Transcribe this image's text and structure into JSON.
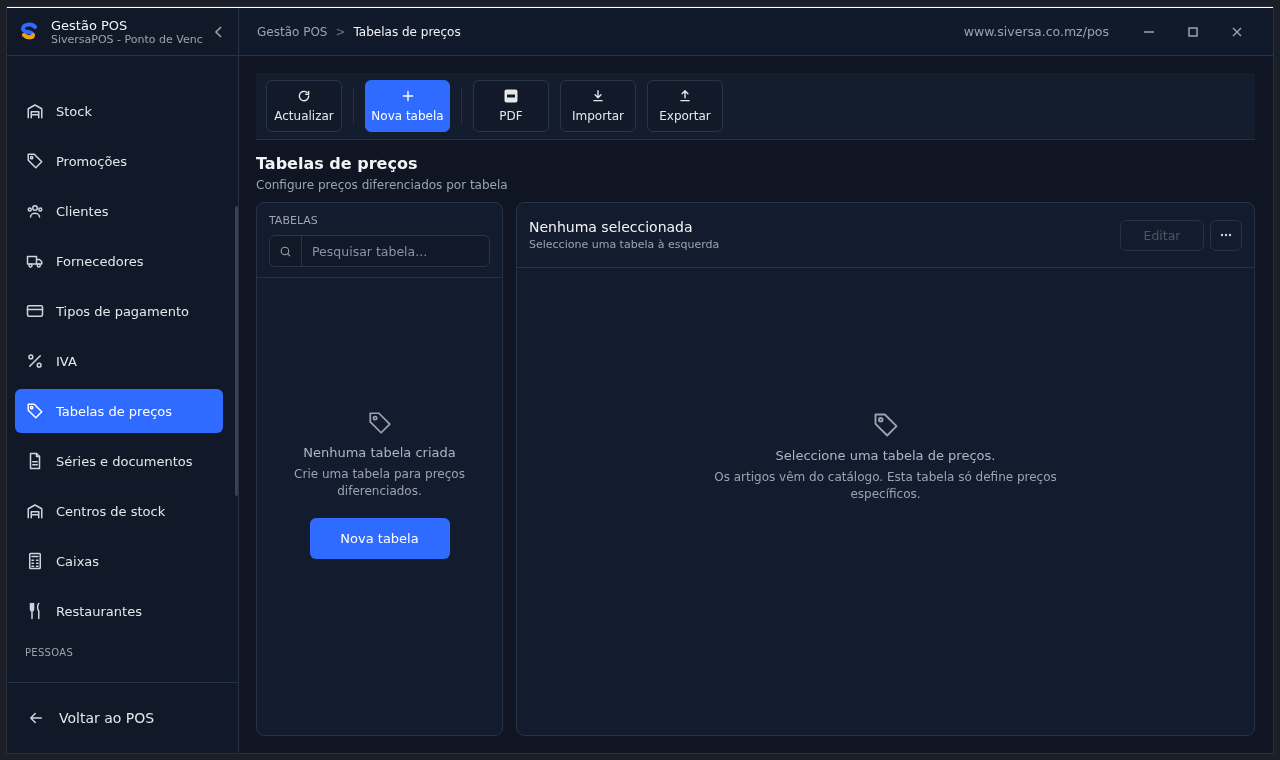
{
  "app": {
    "title": "Gestão POS",
    "subtitle": "SiversaPOS - Ponto de Venc"
  },
  "sidebar": {
    "items": [
      {
        "label": "Stock",
        "selected": false
      },
      {
        "label": "Promoções",
        "selected": false
      },
      {
        "label": "Clientes",
        "selected": false
      },
      {
        "label": "Fornecedores",
        "selected": false
      },
      {
        "label": "Tipos de pagamento",
        "selected": false
      },
      {
        "label": "IVA",
        "selected": false
      },
      {
        "label": "Tabelas de preços",
        "selected": true
      },
      {
        "label": "Séries e documentos",
        "selected": false
      },
      {
        "label": "Centros de stock",
        "selected": false
      },
      {
        "label": "Caixas",
        "selected": false
      },
      {
        "label": "Restaurantes",
        "selected": false
      }
    ],
    "section": "PESSOAS",
    "back": "Voltar ao POS"
  },
  "topbar": {
    "breadcrumb": [
      "Gestão POS",
      "Tabelas de preços"
    ],
    "separator": ">",
    "url": "www.siversa.co.mz/pos"
  },
  "toolbar": [
    {
      "label": "Actualizar",
      "kind": "default"
    },
    {
      "label": "Nova tabela",
      "kind": "primary"
    },
    {
      "label": "PDF",
      "kind": "default"
    },
    {
      "label": "Importar",
      "kind": "default"
    },
    {
      "label": "Exportar",
      "kind": "default"
    }
  ],
  "page": {
    "title": "Tabelas de preços",
    "subtitle": "Configure preços diferenciados por tabela"
  },
  "tables_panel": {
    "heading": "TABELAS",
    "search": {
      "placeholder": "Pesquisar tabela..."
    },
    "empty_title": "Nenhuma tabela criada",
    "empty_text": "Crie uma tabela para preços diferenciados.",
    "button": "Nova tabela"
  },
  "detail_panel": {
    "title": "Nenhuma seleccionada",
    "subtitle": "Seleccione uma tabela à esquerda",
    "edit": {
      "label": "Editar",
      "disabled": true
    },
    "empty_title": "Seleccione uma tabela de preços.",
    "empty_text": "Os artigos vêm do catálogo. Esta tabela só define preços específicos."
  }
}
